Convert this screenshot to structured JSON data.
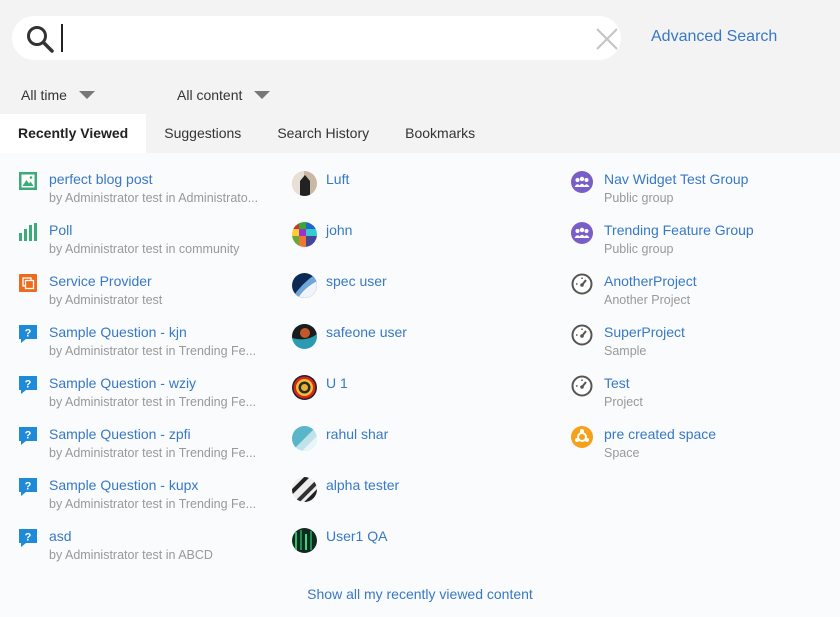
{
  "search": {
    "value": "",
    "placeholder": "",
    "advanced_label": "Advanced Search"
  },
  "filters": {
    "time": "All time",
    "content": "All content"
  },
  "tabs": [
    {
      "label": "Recently Viewed",
      "active": true
    },
    {
      "label": "Suggestions",
      "active": false
    },
    {
      "label": "Search History",
      "active": false
    },
    {
      "label": "Bookmarks",
      "active": false
    }
  ],
  "content_items": [
    {
      "title": "perfect blog post",
      "sub": "by Administrator test in Administrato...",
      "icon": "blog-post-icon"
    },
    {
      "title": "Poll",
      "sub": "by Administrator test in community",
      "icon": "poll-icon"
    },
    {
      "title": "Service Provider",
      "sub": "by Administrator test",
      "icon": "document-icon"
    },
    {
      "title": "Sample Question - kjn",
      "sub": "by Administrator test in Trending Fe...",
      "icon": "question-icon"
    },
    {
      "title": "Sample Question - wziy",
      "sub": "by Administrator test in Trending Fe...",
      "icon": "question-icon"
    },
    {
      "title": "Sample Question - zpfi",
      "sub": "by Administrator test in Trending Fe...",
      "icon": "question-icon"
    },
    {
      "title": "Sample Question - kupx",
      "sub": "by Administrator test in Trending Fe...",
      "icon": "question-icon"
    },
    {
      "title": "asd",
      "sub": "by Administrator test in ABCD",
      "icon": "question-icon"
    }
  ],
  "people": [
    {
      "name": "Luft"
    },
    {
      "name": "john"
    },
    {
      "name": "spec user"
    },
    {
      "name": "safeone user"
    },
    {
      "name": "U 1"
    },
    {
      "name": "rahul shar"
    },
    {
      "name": "alpha tester"
    },
    {
      "name": "User1 QA"
    }
  ],
  "places": [
    {
      "title": "Nav Widget Test Group",
      "sub": "Public group",
      "icon": "group-icon"
    },
    {
      "title": "Trending Feature Group",
      "sub": "Public group",
      "icon": "group-icon"
    },
    {
      "title": "AnotherProject",
      "sub": "Another Project",
      "icon": "project-gauge-icon"
    },
    {
      "title": "SuperProject",
      "sub": "Sample",
      "icon": "project-gauge-icon"
    },
    {
      "title": "Test",
      "sub": "Project",
      "icon": "project-gauge-icon"
    },
    {
      "title": "pre created space",
      "sub": "Space",
      "icon": "space-icon"
    }
  ],
  "footer": {
    "show_all": "Show all my recently viewed content"
  },
  "colors": {
    "link": "#3778c7",
    "blog": "#3bab7a",
    "poll": "#3bab7a",
    "document": "#ee6a1c",
    "question": "#1f8ad8",
    "group": "#7a5ec7",
    "project": "#555555",
    "space": "#f5a11a"
  }
}
